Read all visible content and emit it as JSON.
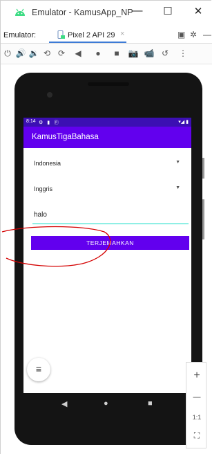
{
  "window": {
    "title": "Emulator - KamusApp_NP",
    "minimize": "—",
    "maximize": "☐",
    "close": "✕"
  },
  "emulator_tabs": {
    "label": "Emulator:",
    "active_tab": "Pixel 2 API 29",
    "close_glyph": "×",
    "right_icons": [
      "window-icon",
      "gear-icon",
      "minimize-panel-icon"
    ]
  },
  "toolbar": {
    "icons": [
      "power-icon",
      "volume-up-icon",
      "volume-down-icon",
      "rotate-left-icon",
      "rotate-right-icon",
      "back-icon",
      "home-icon",
      "overview-icon",
      "camera-icon",
      "video-icon",
      "undo-icon",
      "more-icon"
    ],
    "glyphs": [
      "⏻",
      "🔊",
      "🔉",
      "⟲",
      "⟳",
      "◀",
      "●",
      "■",
      "📷",
      "📹",
      "↺",
      "⋮"
    ]
  },
  "device": {
    "status_bar": {
      "time": "8:14",
      "icons": "⚙ ▮ ⓟ",
      "system": "▾◢ ▮"
    },
    "app_title": "KamusTigaBahasa",
    "source_language": {
      "value": "Indonesia",
      "arrow": "▼"
    },
    "target_language": {
      "value": "Inggris",
      "arrow": "▼"
    },
    "input": {
      "value": "halo"
    },
    "translate_button": "TERJEMAHKAN",
    "fab_glyph": "≡",
    "nav": {
      "back": "◀",
      "home": "●",
      "recents": "■"
    }
  },
  "side_panel": {
    "zoom_in": "+",
    "zoom_out": "—",
    "ratio": "1:1",
    "fit": "⛶"
  },
  "colors": {
    "status_bar": "#3c0fb3",
    "app_bar": "#6200ee",
    "accent_underline": "#03dac5",
    "annotation_circle": "#d40000"
  }
}
